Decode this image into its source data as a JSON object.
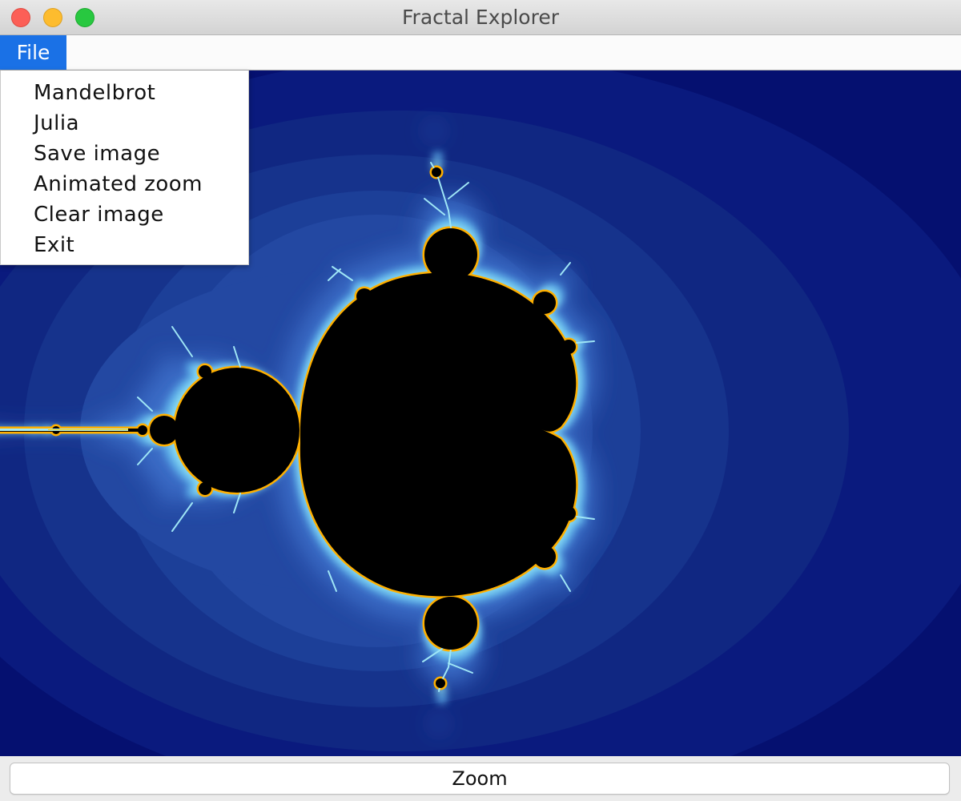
{
  "window": {
    "title": "Fractal Explorer"
  },
  "menubar": {
    "file_label": "File"
  },
  "file_menu": {
    "items": [
      {
        "label": "Mandelbrot"
      },
      {
        "label": "Julia"
      },
      {
        "label": "Save image"
      },
      {
        "label": "Animated zoom"
      },
      {
        "label": "Clear image"
      },
      {
        "label": "Exit"
      }
    ]
  },
  "toolbar": {
    "zoom_label": "Zoom"
  },
  "colors": {
    "menu_highlight": "#1a71e6",
    "fractal_background": "#051070",
    "fractal_inside": "#000000",
    "fractal_edge_yellow": "#ffc800",
    "fractal_edge_cyan": "#70d8f0"
  }
}
